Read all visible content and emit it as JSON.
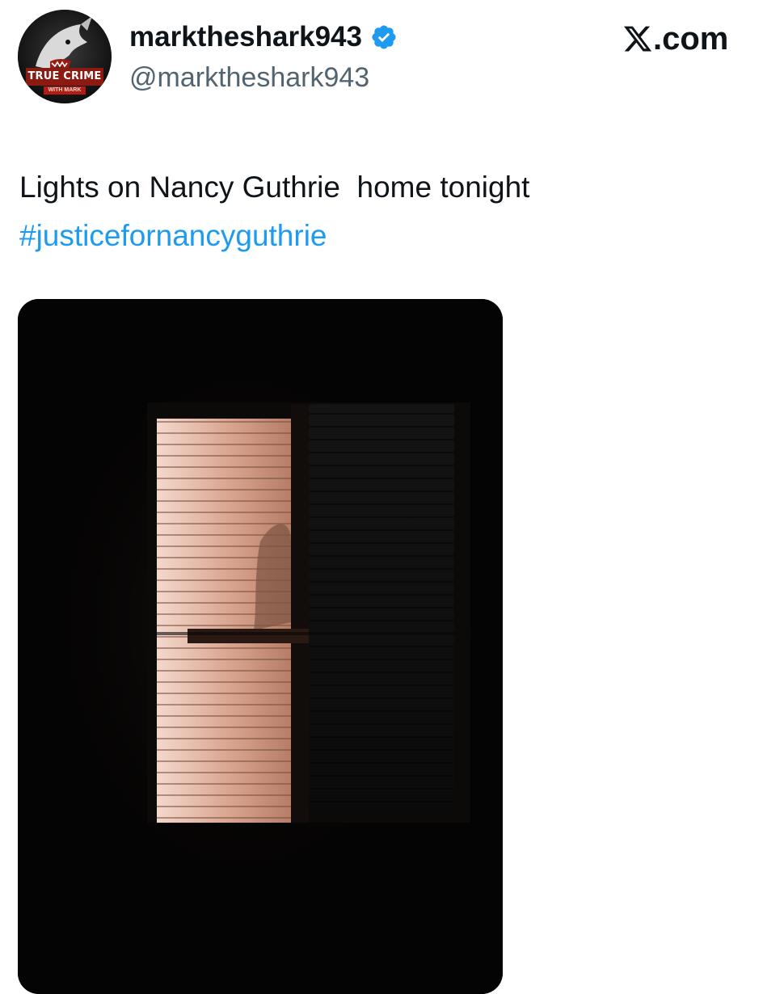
{
  "author": {
    "display_name": "marktheshark943",
    "handle": "@marktheshark943",
    "verified": true,
    "avatar": {
      "label_main": "TRUE CRIME",
      "label_sub": "WITH MARK",
      "icon": "shark-icon"
    }
  },
  "brand": {
    "icon": "x-logo-icon",
    "text": ".com"
  },
  "tweet": {
    "text": "Lights on Nancy Guthrie  home tonight",
    "hashtag": "#justicefornancyguthrie"
  },
  "media": {
    "type": "photo",
    "subject": "window-with-blinds-at-night"
  },
  "colors": {
    "link": "#1d9bf0",
    "verified_badge": "#1d9bf0",
    "text_primary": "#0f1419",
    "text_secondary": "#536471",
    "avatar_banner": "#8b1a12"
  }
}
